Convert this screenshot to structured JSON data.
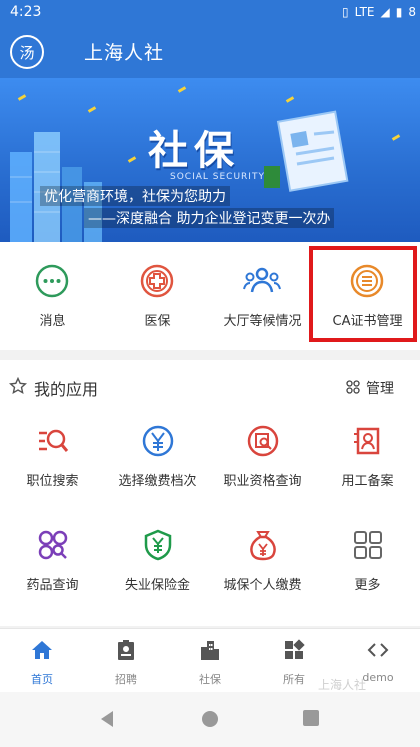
{
  "status": {
    "time": "4:23",
    "network": "LTE",
    "battery": "8"
  },
  "appbar": {
    "logo_text": "汤",
    "title": "上海人社"
  },
  "banner": {
    "title": "社保",
    "subtitle_en": "SOCIAL SECURITY",
    "line1": "优化营商环境，社保为您助力",
    "line2": "——深度融合 助力企业登记变更一次办"
  },
  "quick_actions": [
    {
      "label": "消息",
      "icon": "chat-bubble-icon",
      "color": "#2e9a5b"
    },
    {
      "label": "医保",
      "icon": "medical-cross-icon",
      "color": "#e0553f"
    },
    {
      "label": "大厅等候情况",
      "icon": "people-group-icon",
      "color": "#2f77d6"
    },
    {
      "label": "CA证书管理",
      "icon": "list-circle-icon",
      "color": "#e8892a"
    }
  ],
  "my_apps": {
    "title": "我的应用",
    "manage_label": "管理",
    "items": [
      {
        "label": "职位搜索",
        "icon": "job-search-icon"
      },
      {
        "label": "选择缴费档次",
        "icon": "yuan-coin-icon"
      },
      {
        "label": "职业资格查询",
        "icon": "certificate-search-icon"
      },
      {
        "label": "用工备案",
        "icon": "employee-record-icon"
      },
      {
        "label": "药品查询",
        "icon": "pills-icon"
      },
      {
        "label": "失业保险金",
        "icon": "shield-yuan-icon"
      },
      {
        "label": "城保个人缴费",
        "icon": "money-bag-icon"
      },
      {
        "label": "更多",
        "icon": "more-grid-icon"
      }
    ]
  },
  "tabs": [
    {
      "label": "首页",
      "icon": "home-icon",
      "active": true
    },
    {
      "label": "招聘",
      "icon": "badge-icon",
      "active": false
    },
    {
      "label": "社保",
      "icon": "buildings-icon",
      "active": false
    },
    {
      "label": "所有",
      "icon": "all-apps-icon",
      "active": false
    },
    {
      "label": "demo",
      "icon": "code-icon",
      "active": false
    }
  ],
  "watermark": "上海人社"
}
